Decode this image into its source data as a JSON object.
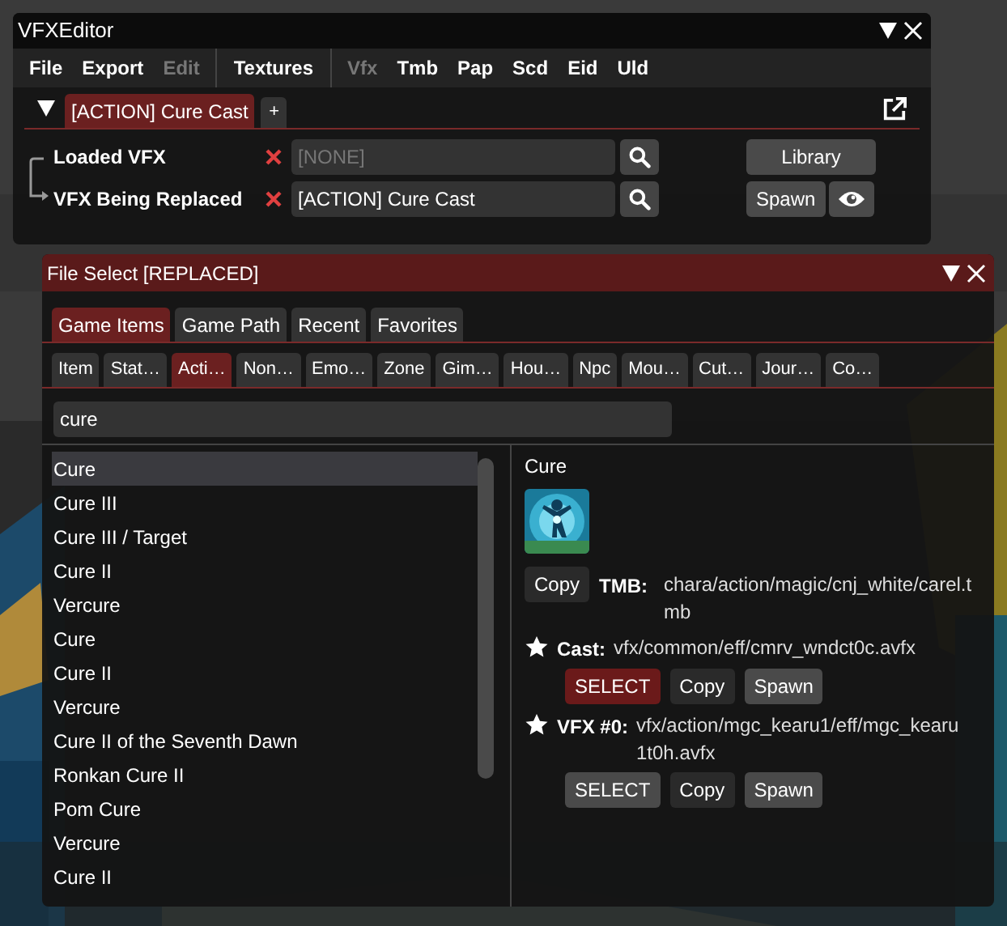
{
  "main_window": {
    "title": "VFXEditor",
    "menu_groups": [
      {
        "items": [
          {
            "label": "File",
            "disabled": false
          },
          {
            "label": "Export",
            "disabled": false
          },
          {
            "label": "Edit",
            "disabled": true
          }
        ]
      },
      {
        "items": [
          {
            "label": "Textures",
            "disabled": false
          }
        ]
      },
      {
        "items": [
          {
            "label": "Vfx",
            "disabled": true
          },
          {
            "label": "Tmb",
            "disabled": false
          },
          {
            "label": "Pap",
            "disabled": false
          },
          {
            "label": "Scd",
            "disabled": false
          },
          {
            "label": "Eid",
            "disabled": false
          },
          {
            "label": "Uld",
            "disabled": false
          }
        ]
      }
    ],
    "document_tabs": [
      {
        "label": "[ACTION] Cure Cast",
        "selected": true
      }
    ],
    "add_tab": "+",
    "fields": [
      {
        "label": "Loaded VFX",
        "placeholder": "[NONE]"
      },
      {
        "label": "VFX Being Replaced",
        "value": "[ACTION] Cure Cast"
      }
    ],
    "library_button": "Library",
    "spawn_button": "Spawn"
  },
  "file_select": {
    "title": "File Select [REPLACED]",
    "source_tabs": [
      {
        "label": "Game Items",
        "selected": true
      },
      {
        "label": "Game Path",
        "selected": false
      },
      {
        "label": "Recent",
        "selected": false
      },
      {
        "label": "Favorites",
        "selected": false
      }
    ],
    "category_tabs": [
      {
        "label": "Item",
        "selected": false
      },
      {
        "label": "Stat…",
        "selected": false
      },
      {
        "label": "Acti…",
        "selected": true
      },
      {
        "label": "Non…",
        "selected": false
      },
      {
        "label": "Emo…",
        "selected": false
      },
      {
        "label": "Zone",
        "selected": false
      },
      {
        "label": "Gim…",
        "selected": false
      },
      {
        "label": "Hou…",
        "selected": false
      },
      {
        "label": "Npc",
        "selected": false
      },
      {
        "label": "Mou…",
        "selected": false
      },
      {
        "label": "Cut…",
        "selected": false
      },
      {
        "label": "Jour…",
        "selected": false
      },
      {
        "label": "Co…",
        "selected": false
      }
    ],
    "search": {
      "value": "cure"
    },
    "results": [
      {
        "label": "Cure",
        "selected": true
      },
      {
        "label": "Cure III",
        "selected": false
      },
      {
        "label": "Cure III / Target",
        "selected": false
      },
      {
        "label": "Cure II",
        "selected": false
      },
      {
        "label": "Vercure",
        "selected": false
      },
      {
        "label": "Cure",
        "selected": false
      },
      {
        "label": "Cure II",
        "selected": false
      },
      {
        "label": "Vercure",
        "selected": false
      },
      {
        "label": "Cure II of the Seventh Dawn",
        "selected": false
      },
      {
        "label": "Ronkan Cure II",
        "selected": false
      },
      {
        "label": "Pom Cure",
        "selected": false
      },
      {
        "label": "Vercure",
        "selected": false
      },
      {
        "label": "Cure II",
        "selected": false
      }
    ],
    "detail": {
      "title": "Cure",
      "copy_button": "Copy",
      "tmb_label": "TMB:",
      "tmb_path": "chara/action/magic/cnj_white/carel.tmb",
      "entries": [
        {
          "label": "Cast:",
          "path": "vfx/common/eff/cmrv_wndct0c.avfx",
          "selected": true,
          "select_button": "SELECT",
          "copy_button": "Copy",
          "spawn_button": "Spawn"
        },
        {
          "label": "VFX #0:",
          "path": "vfx/action/mgc_kearu1/eff/mgc_kearu1t0h.avfx",
          "selected": false,
          "select_button": "SELECT",
          "copy_button": "Copy",
          "spawn_button": "Spawn"
        }
      ]
    }
  }
}
